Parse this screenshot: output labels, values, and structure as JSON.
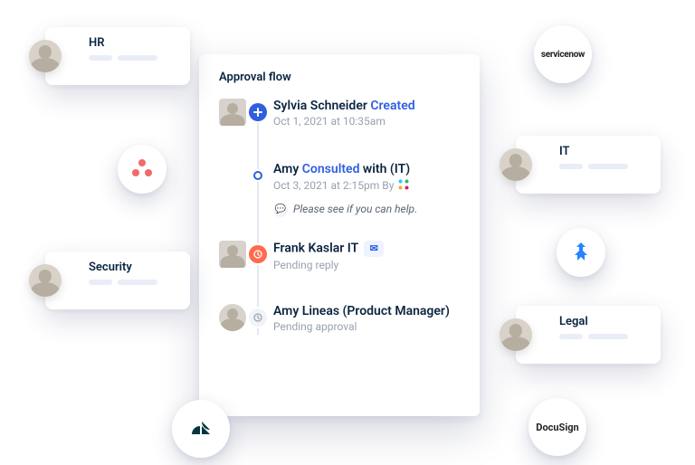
{
  "card": {
    "title": "Approval flow",
    "items": [
      {
        "name_a": "Sylvia Schneider ",
        "name_b": "Created",
        "meta": "Oct 1, 2021 at 10:35am",
        "badge": "plus"
      },
      {
        "name_a": "Amy ",
        "name_b": "Consulted",
        "name_c": " with (IT)",
        "meta": "Oct 3, 2021 at 2:15pm By",
        "note": "Please see if you can help.",
        "via": "slack",
        "badge": "dot"
      },
      {
        "name_a": "Frank Kaslar IT",
        "meta": "Pending reply",
        "mail": true,
        "badge": "clock"
      },
      {
        "name_a": "Amy Lineas (Product Manager)",
        "meta": "Pending approval",
        "badge": "clock-gray"
      }
    ]
  },
  "pills": {
    "hr": "HR",
    "security": "Security",
    "it": "IT",
    "legal": "Legal"
  },
  "integrations": {
    "servicenow": "servicenow",
    "docusign": "DocuSign"
  }
}
